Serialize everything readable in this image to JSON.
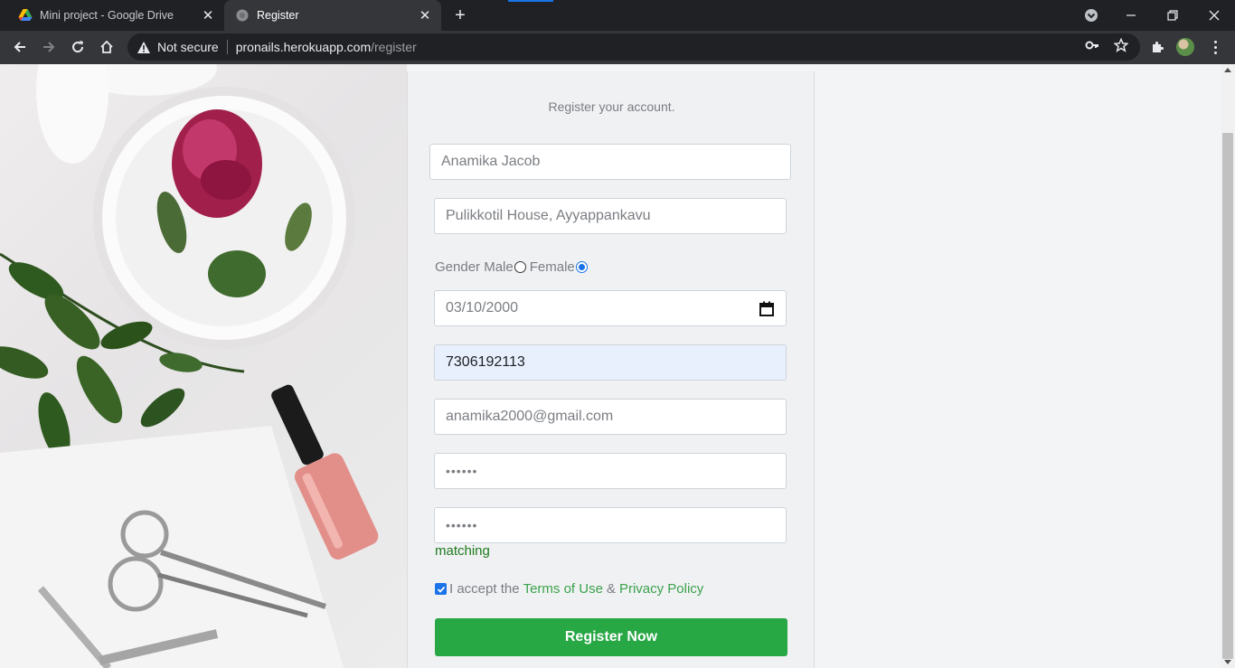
{
  "browser": {
    "tabs": [
      {
        "title": "Mini project - Google Drive",
        "favicon": "google-drive-icon",
        "active": false
      },
      {
        "title": "Register",
        "favicon": "globe-icon",
        "active": true
      }
    ],
    "address": {
      "security_label": "Not secure",
      "host": "pronails.herokuapp.com",
      "path": "/register"
    }
  },
  "form": {
    "subtitle": "Register your account.",
    "name": "Anamika Jacob",
    "address": "Pulikkotil House, Ayyappankavu",
    "gender_label": "Gender",
    "gender_male": "Male",
    "gender_female": "Female",
    "gender_selected": "Female",
    "dob": "03/10/2000",
    "phone": "7306192113",
    "email": "anamika2000@gmail.com",
    "password_mask": "••••••",
    "confirm_mask": "••••••",
    "match_status": "matching",
    "terms_prefix": "I accept the",
    "terms_link": "Terms of Use",
    "terms_and": "&",
    "privacy_link": "Privacy Policy",
    "terms_checked": true,
    "submit_label": "Register Now"
  },
  "colors": {
    "submit": "#28a745",
    "link": "#3ba24c",
    "match": "#1e7b1e",
    "accent": "#1a73e8"
  }
}
